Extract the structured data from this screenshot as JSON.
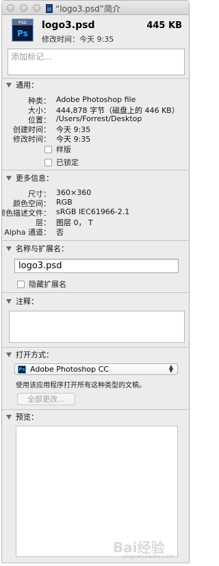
{
  "window": {
    "title": "“logo3.psd”简介"
  },
  "header": {
    "file_name": "logo3.psd",
    "file_size": "445 KB",
    "modified_label": "修改时间：",
    "modified_value": "今天 9:35",
    "icon_label": "Ps",
    "icon_tag": "PSD"
  },
  "tags": {
    "placeholder": "添加标记…"
  },
  "general": {
    "title": "通用：",
    "rows": [
      {
        "key": "种类：",
        "value": "Adobe Photoshop file"
      },
      {
        "key": "大小：",
        "value": "444,878 字节（磁盘上的 446 KB）"
      },
      {
        "key": "位置：",
        "value": "/Users/Forrest/Desktop"
      },
      {
        "key": "创建时间：",
        "value": "今天 9:35"
      },
      {
        "key": "修改时间：",
        "value": "今天 9:35"
      }
    ],
    "stationery_label": "样版",
    "locked_label": "已锁定"
  },
  "more_info": {
    "title": "更多信息：",
    "rows": [
      {
        "key": "尺寸：",
        "value": "360×360"
      },
      {
        "key": "颜色空间：",
        "value": "RGB"
      },
      {
        "key": "颜色描述文件：",
        "value": "sRGB IEC61966-2.1"
      },
      {
        "key": "层：",
        "value": "图层 0， T"
      },
      {
        "key": "Alpha 通道：",
        "value": "否"
      }
    ]
  },
  "name_ext": {
    "title": "名称与扩展名：",
    "value": "logo3.psd",
    "hide_ext_label": "隐藏扩展名"
  },
  "comments": {
    "title": "注释："
  },
  "open_with": {
    "title": "打开方式：",
    "app": "Adobe Photoshop CC",
    "app_icon": "Ps",
    "description": "使用该应用程序打开所有这种类型的文稿。",
    "change_all_label": "全部更改…"
  },
  "preview": {
    "title": "预览："
  },
  "watermark": {
    "text": "Bai经验",
    "sub": "jingyan.baidu.com"
  }
}
